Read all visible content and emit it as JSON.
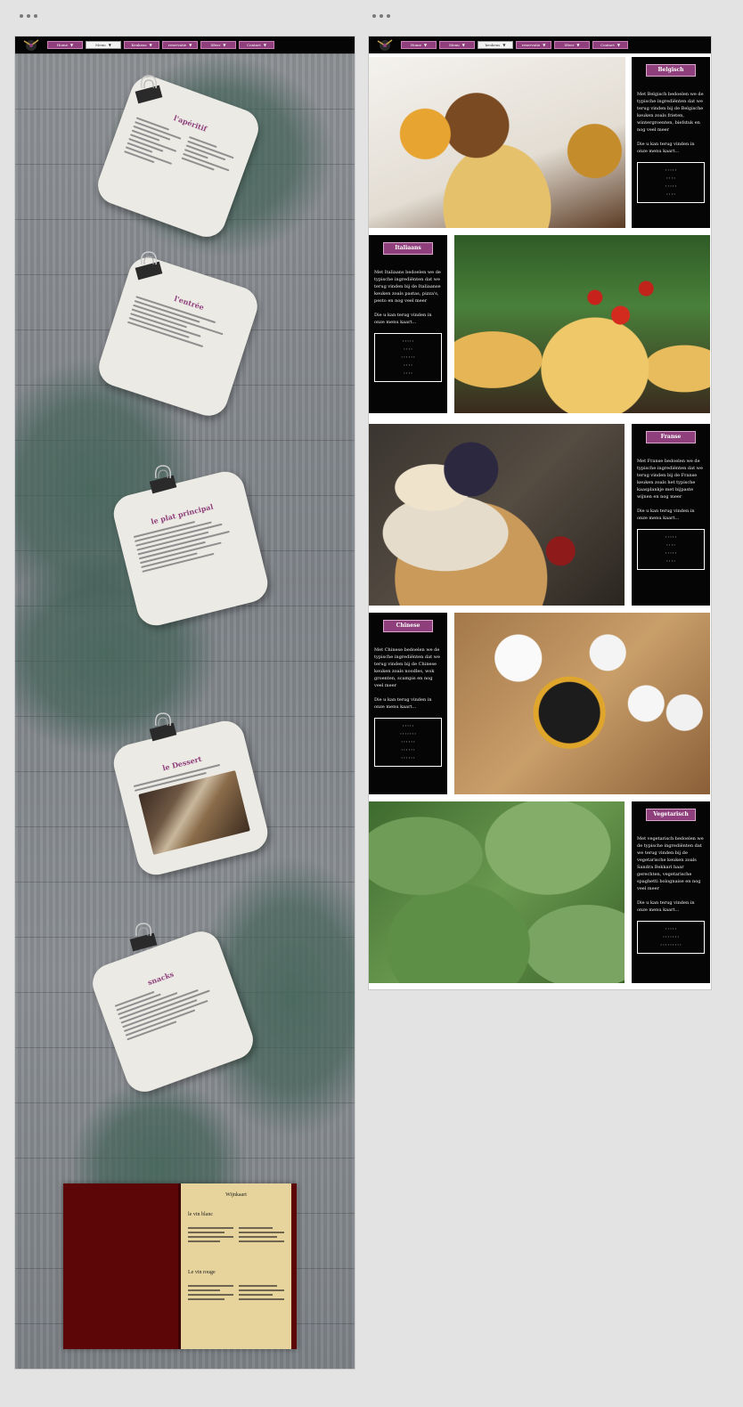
{
  "left_frame": {
    "nav": [
      "Home",
      "Menu",
      "Keukens",
      "reservatie",
      "Sfeer",
      "Contact"
    ],
    "active_nav": "Menu",
    "cards": {
      "aperitif": "l'apéritif",
      "entree": "l'entrée",
      "plat": "le plat principal",
      "dessert_title": "le Dessert",
      "snacks": "snacks"
    },
    "wine": {
      "title": "Wijnkaart",
      "white": "le vin blanc",
      "red": "Le vin rouge"
    }
  },
  "right_frame": {
    "nav": [
      "Home",
      "Menu",
      "keukens",
      "reservatie",
      "Sfeer",
      "Contact"
    ],
    "active_nav": "keukens",
    "sections": [
      {
        "tag": "Belgisch",
        "text": "Met Belgisch bedoelen we de typische ingrediënten dat we terug vinden bij de Belgische keuken zoals frieten, wintergroenten, biefstuk en nog veel meer",
        "more": "Die u kan terug vinden in onze menu kaart..."
      },
      {
        "tag": "Italiaans",
        "text": "Met Italiaans bedoelen we de typische ingrediënten dat we terug vinden bij de Italiaanse keuken zoals pastas, pizza's, pesto en nog veel meer",
        "more": "Die u kan terug vinden in onze menu kaart..."
      },
      {
        "tag": "Franse",
        "text": "Met Franse bedoelen we de typische ingrediënten dat we terug vinden bij de Franse keuken zoals het typische kaasplankje met bijpaste wijnen en nog meer",
        "more": "Die u kan terug vinden in onze menu kaart..."
      },
      {
        "tag": "Chinese",
        "text": "Met Chinese bedoelen we de typische ingrediënten dat we terug vinden bij de Chinese keuken zoals noodles, wok groenten, scampis en nog veel meer",
        "more": "Die u kan terug vinden in onze menu kaart..."
      },
      {
        "tag": "Vegetarisch",
        "text": "Met vegetarisch bedoelen we de typische ingrediënten dat we terug vinden bij de vegetarische keuken zoals Sandra Bekkari haar gerechten, vegetarische spaghetti bolognaise en nog veel meer",
        "more": "Die u kan terug vinden in onze menu kaart..."
      }
    ]
  }
}
